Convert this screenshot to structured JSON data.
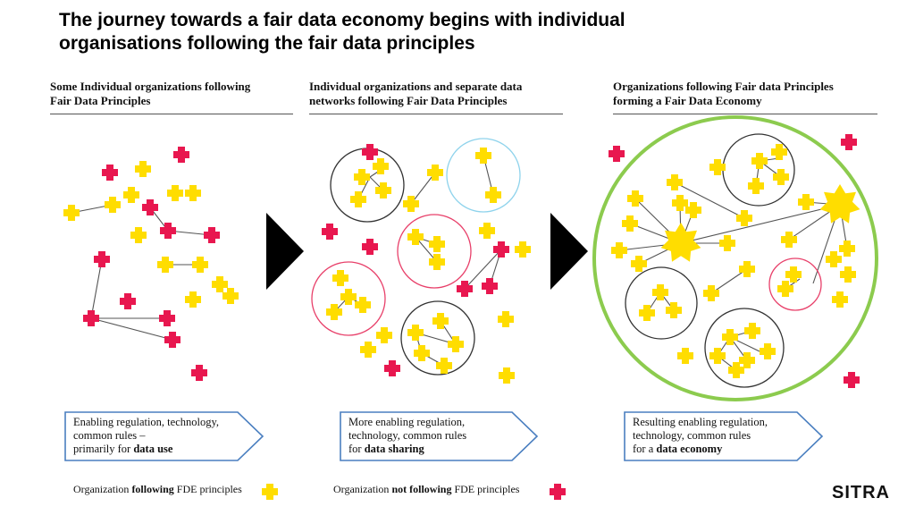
{
  "title": {
    "line1": "The journey towards a fair data economy begins with individual",
    "line2": "organisations following the fair data principles"
  },
  "panels": [
    {
      "heading_line1": "Some Individual organizations following",
      "heading_line2": "Fair Data Principles",
      "callout": {
        "line1": "Enabling regulation, technology,",
        "line2": "common rules –",
        "line3_prefix": "primarily for ",
        "line3_bold": "data use"
      }
    },
    {
      "heading_line1": "Individual organizations and separate data",
      "heading_line2": "networks following Fair Data Principles",
      "callout": {
        "line1": "More enabling regulation,",
        "line2": "technology, common rules",
        "line3_prefix": "for ",
        "line3_bold": "data sharing"
      }
    },
    {
      "heading_line1": "Organizations following Fair data Principles",
      "heading_line2": "forming a Fair Data Economy",
      "callout": {
        "line1": "Resulting enabling regulation,",
        "line2": "technology, common rules",
        "line3_prefix": "for a ",
        "line3_bold": "data economy"
      }
    }
  ],
  "legend": {
    "following": {
      "prefix": "Organization ",
      "bold": "following",
      "suffix": " FDE principles",
      "icon": "yellow-cross-icon"
    },
    "not_following": {
      "prefix": "Organization ",
      "bold": "not following",
      "suffix": " FDE principles",
      "icon": "red-cross-icon"
    }
  },
  "logo": "SITRA",
  "colors": {
    "following": "#FFDD00",
    "not_following": "#E8174F",
    "circle_black": "#333333",
    "circle_blue": "#8FD3EC",
    "circle_red": "#E8406A",
    "economy_ring": "#8CCB4E",
    "callout_border": "#4A7FC0",
    "arrow": "#000000"
  }
}
